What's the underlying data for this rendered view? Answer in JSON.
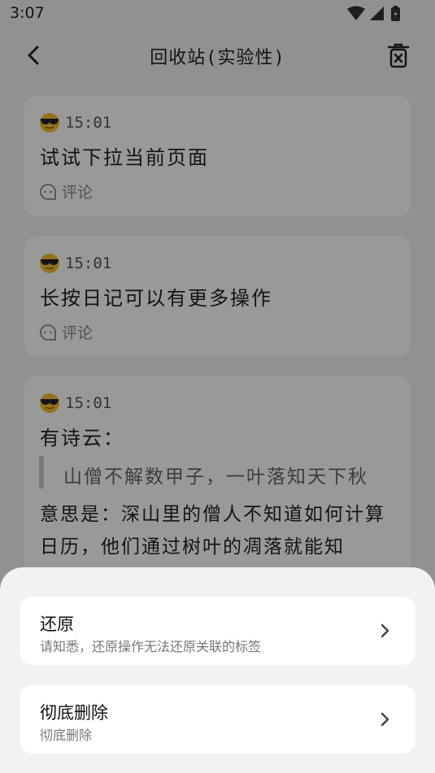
{
  "status_bar": {
    "time": "3:07"
  },
  "header": {
    "title": "回收站(实验性)",
    "back_icon": "chevron-left-icon",
    "trash_icon": "trash-x-icon"
  },
  "cards": [
    {
      "time": "15:01",
      "text": "试试下拉当前页面",
      "comment_label": "评论"
    },
    {
      "time": "15:01",
      "text": "长按日记可以有更多操作",
      "comment_label": "评论"
    },
    {
      "time": "15:01",
      "text": "有诗云：",
      "quote": "山僧不解数甲子，一叶落知天下秋",
      "paragraph": "意思是：深山里的僧人不知道如何计算日历，他们通过树叶的凋落就能知"
    }
  ],
  "sheet": {
    "options": [
      {
        "title": "还原",
        "subtitle": "请知悉，还原操作无法还原关联的标签"
      },
      {
        "title": "彻底删除",
        "subtitle": "彻底删除"
      }
    ]
  },
  "colors": {
    "overlay": "rgba(0,0,0,0.4)",
    "card": "#ffffff",
    "background": "#f2f2f2"
  }
}
